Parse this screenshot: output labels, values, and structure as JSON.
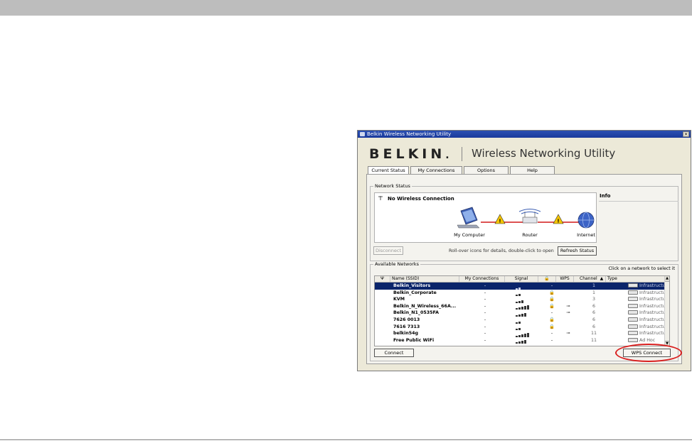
{
  "window": {
    "title": "Belkin Wireless Networking Utility",
    "close_glyph": "×",
    "brand": "BELKIN",
    "brand_dot": ".",
    "app_title": "Wireless Networking Utility"
  },
  "tabs": [
    {
      "label": "Current Status"
    },
    {
      "label": "My Connections"
    },
    {
      "label": "Options"
    },
    {
      "label": "Help"
    }
  ],
  "network_status": {
    "group_label": "Network Status",
    "connection_text": "No Wireless Connection",
    "info_label": "Info",
    "computer_label": "My Computer",
    "router_label": "Router",
    "internet_label": "Internet",
    "warning_glyph": "!",
    "disconnect_label": "Disconnect",
    "hint": "Roll-over icons for details, double-click to open",
    "refresh_label": "Refresh Status"
  },
  "available_networks": {
    "group_label": "Available Networks",
    "select_hint": "Click on a network to select it",
    "columns": {
      "name": "Name (SSID)",
      "my_connections": "My Connections",
      "signal": "Signal",
      "wps": "WPS",
      "channel": "Channel",
      "type": "Type"
    },
    "rows": [
      {
        "name": "Belkin_Visitors",
        "conn": "-",
        "signal": 2,
        "lock": "-",
        "wps": "",
        "channel": "1",
        "type": "Infrastructure"
      },
      {
        "name": "Belkin_Corporate",
        "conn": "-",
        "signal": 2,
        "lock": "🔒",
        "wps": "",
        "channel": "1",
        "type": "Infrastructure"
      },
      {
        "name": "KVM",
        "conn": "-",
        "signal": 3,
        "lock": "🔒",
        "wps": "",
        "channel": "3",
        "type": "Infrastructure"
      },
      {
        "name": "Belkin_N_Wireless_66A...",
        "conn": "-",
        "signal": 5,
        "lock": "🔒",
        "wps": "⊸",
        "channel": "6",
        "type": "Infrastructure"
      },
      {
        "name": "Belkin_N1_0535FA",
        "conn": "-",
        "signal": 4,
        "lock": "-",
        "wps": "⊸",
        "channel": "6",
        "type": "Infrastructure"
      },
      {
        "name": "7626 0013",
        "conn": "-",
        "signal": 2,
        "lock": "🔒",
        "wps": "",
        "channel": "6",
        "type": "Infrastructure"
      },
      {
        "name": "7616 7313",
        "conn": "-",
        "signal": 2,
        "lock": "🔒",
        "wps": "",
        "channel": "6",
        "type": "Infrastructure"
      },
      {
        "name": "belkin54g",
        "conn": "-",
        "signal": 5,
        "lock": "-",
        "wps": "⊸",
        "channel": "11",
        "type": "Infrastructure"
      },
      {
        "name": "Free Public WiFi",
        "conn": "-",
        "signal": 4,
        "lock": "-",
        "wps": "",
        "channel": "11",
        "type": "Ad Hoc"
      }
    ],
    "connect_label": "Connect",
    "wps_connect_label": "WPS Connect"
  },
  "colors": {
    "selection": "#0a246a",
    "warning": "#f4c400",
    "link_red": "#d21919",
    "highlight": "#d91f1f"
  }
}
